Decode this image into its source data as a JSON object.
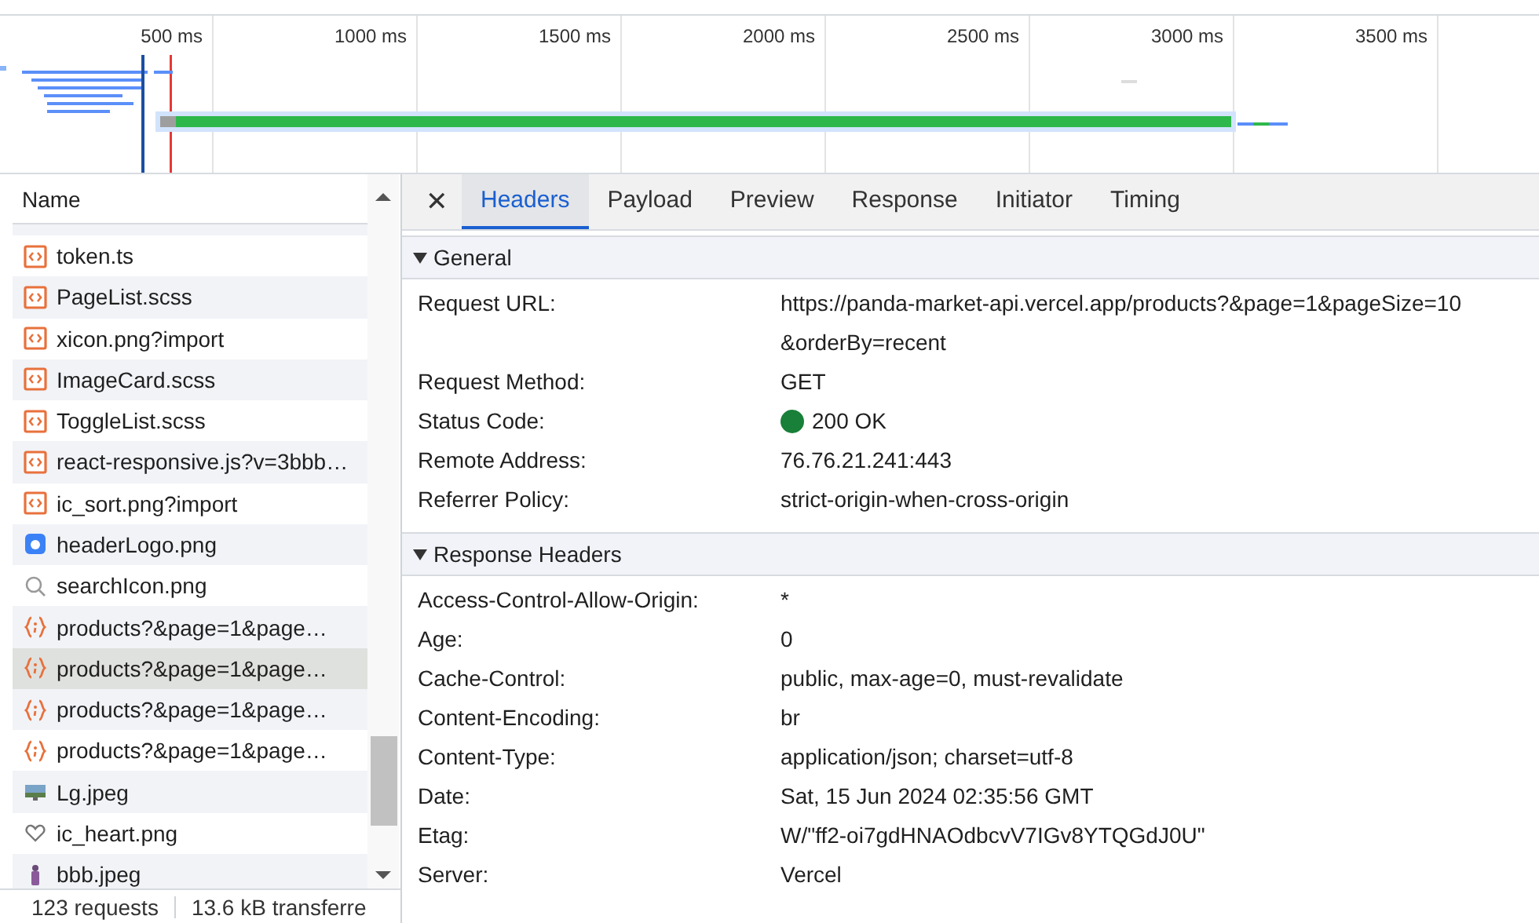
{
  "timeline": {
    "ticks": [
      "500 ms",
      "1000 ms",
      "1500 ms",
      "2000 ms",
      "2500 ms",
      "3000 ms",
      "3500 ms"
    ]
  },
  "request_list": {
    "header": "Name",
    "rows": [
      {
        "name": "token.ts",
        "kind": "script",
        "selected": false
      },
      {
        "name": "PageList.scss",
        "kind": "script",
        "selected": false
      },
      {
        "name": "xicon.png?import",
        "kind": "script",
        "selected": false
      },
      {
        "name": "ImageCard.scss",
        "kind": "script",
        "selected": false
      },
      {
        "name": "ToggleList.scss",
        "kind": "script",
        "selected": false
      },
      {
        "name": "react-responsive.js?v=3bbb…",
        "kind": "script",
        "selected": false
      },
      {
        "name": "ic_sort.png?import",
        "kind": "script",
        "selected": false
      },
      {
        "name": "headerLogo.png",
        "kind": "logo",
        "selected": false
      },
      {
        "name": "searchIcon.png",
        "kind": "search",
        "selected": false
      },
      {
        "name": "products?&page=1&page…",
        "kind": "fetch",
        "selected": false
      },
      {
        "name": "products?&page=1&page…",
        "kind": "fetch",
        "selected": true
      },
      {
        "name": "products?&page=1&page…",
        "kind": "fetch",
        "selected": false
      },
      {
        "name": "products?&page=1&page…",
        "kind": "fetch",
        "selected": false
      },
      {
        "name": "Lg.jpeg",
        "kind": "image",
        "selected": false
      },
      {
        "name": "ic_heart.png",
        "kind": "heart",
        "selected": false
      },
      {
        "name": "bbb.jpeg",
        "kind": "figure",
        "selected": false
      }
    ]
  },
  "status_bar": {
    "requests": "123 requests",
    "transferred": "13.6 kB transferre"
  },
  "details": {
    "close": "✕",
    "tabs": [
      {
        "label": "Headers",
        "selected": true
      },
      {
        "label": "Payload",
        "selected": false
      },
      {
        "label": "Preview",
        "selected": false
      },
      {
        "label": "Response",
        "selected": false
      },
      {
        "label": "Initiator",
        "selected": false
      },
      {
        "label": "Timing",
        "selected": false
      }
    ],
    "sections": [
      {
        "title": "General",
        "expanded": true,
        "rows": [
          {
            "label": "Request URL:",
            "value": "https://panda-market-api.vercel.app/products?&page=1&pageSize=10 &orderBy=recent"
          },
          {
            "label": "Request Method:",
            "value": "GET"
          },
          {
            "label": "Status Code:",
            "value": "200 OK",
            "kind": "status"
          },
          {
            "label": "Remote Address:",
            "value": "76.76.21.241:443"
          },
          {
            "label": "Referrer Policy:",
            "value": "strict-origin-when-cross-origin"
          }
        ]
      },
      {
        "title": "Response Headers",
        "expanded": true,
        "rows": [
          {
            "label": "Access-Control-Allow-Origin:",
            "value": "*"
          },
          {
            "label": "Age:",
            "value": "0"
          },
          {
            "label": "Cache-Control:",
            "value": "public, max-age=0, must-revalidate"
          },
          {
            "label": "Content-Encoding:",
            "value": "br"
          },
          {
            "label": "Content-Type:",
            "value": "application/json; charset=utf-8"
          },
          {
            "label": "Date:",
            "value": "Sat, 15 Jun 2024 02:35:56 GMT"
          },
          {
            "label": "Etag:",
            "value": "W/\"ff2-oi7gdHNAOdbcvV7IGv8YTQGdJ0U\""
          },
          {
            "label": "Server:",
            "value": "Vercel"
          }
        ]
      }
    ]
  }
}
